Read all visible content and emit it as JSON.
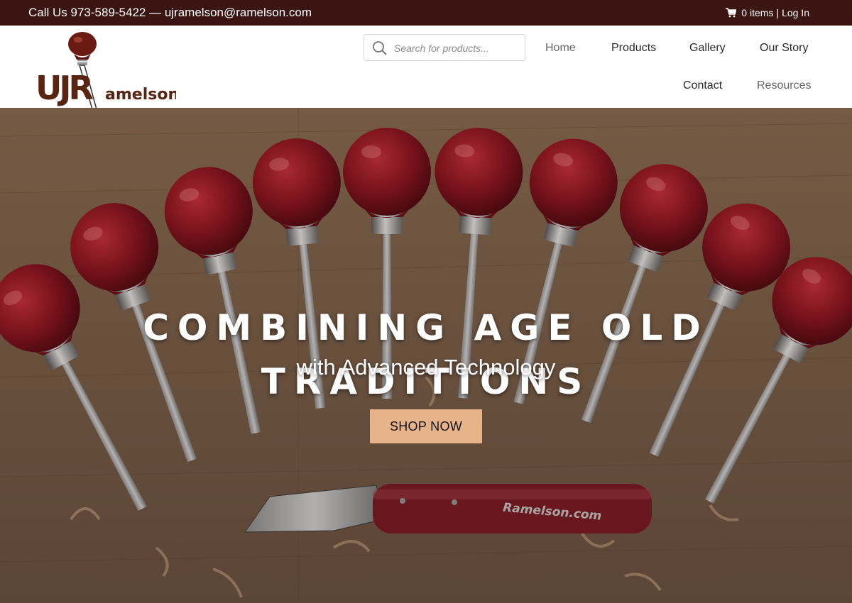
{
  "topbar": {
    "contact": "Call Us 973-589-5422 — ujramelson@ramelson.com",
    "cart": "0 items",
    "separator": "|",
    "login": "Log In",
    "background_color": "#3a1512"
  },
  "header": {
    "logo_text": "UJRamelson",
    "search": {
      "placeholder": "Search for products..."
    },
    "nav": {
      "home": "Home",
      "products": "Products",
      "gallery": "Gallery",
      "our_story": "Our Story",
      "contact": "Contact",
      "resources": "Resources"
    }
  },
  "hero": {
    "title": "COMBINING AGE OLD TRADITIONS",
    "subtitle": "with Advanced Technology",
    "button": "SHOP NOW",
    "knife_brand": "Ramelson.com",
    "button_color": "#e7b48a",
    "handle_color": "#8e1420"
  }
}
